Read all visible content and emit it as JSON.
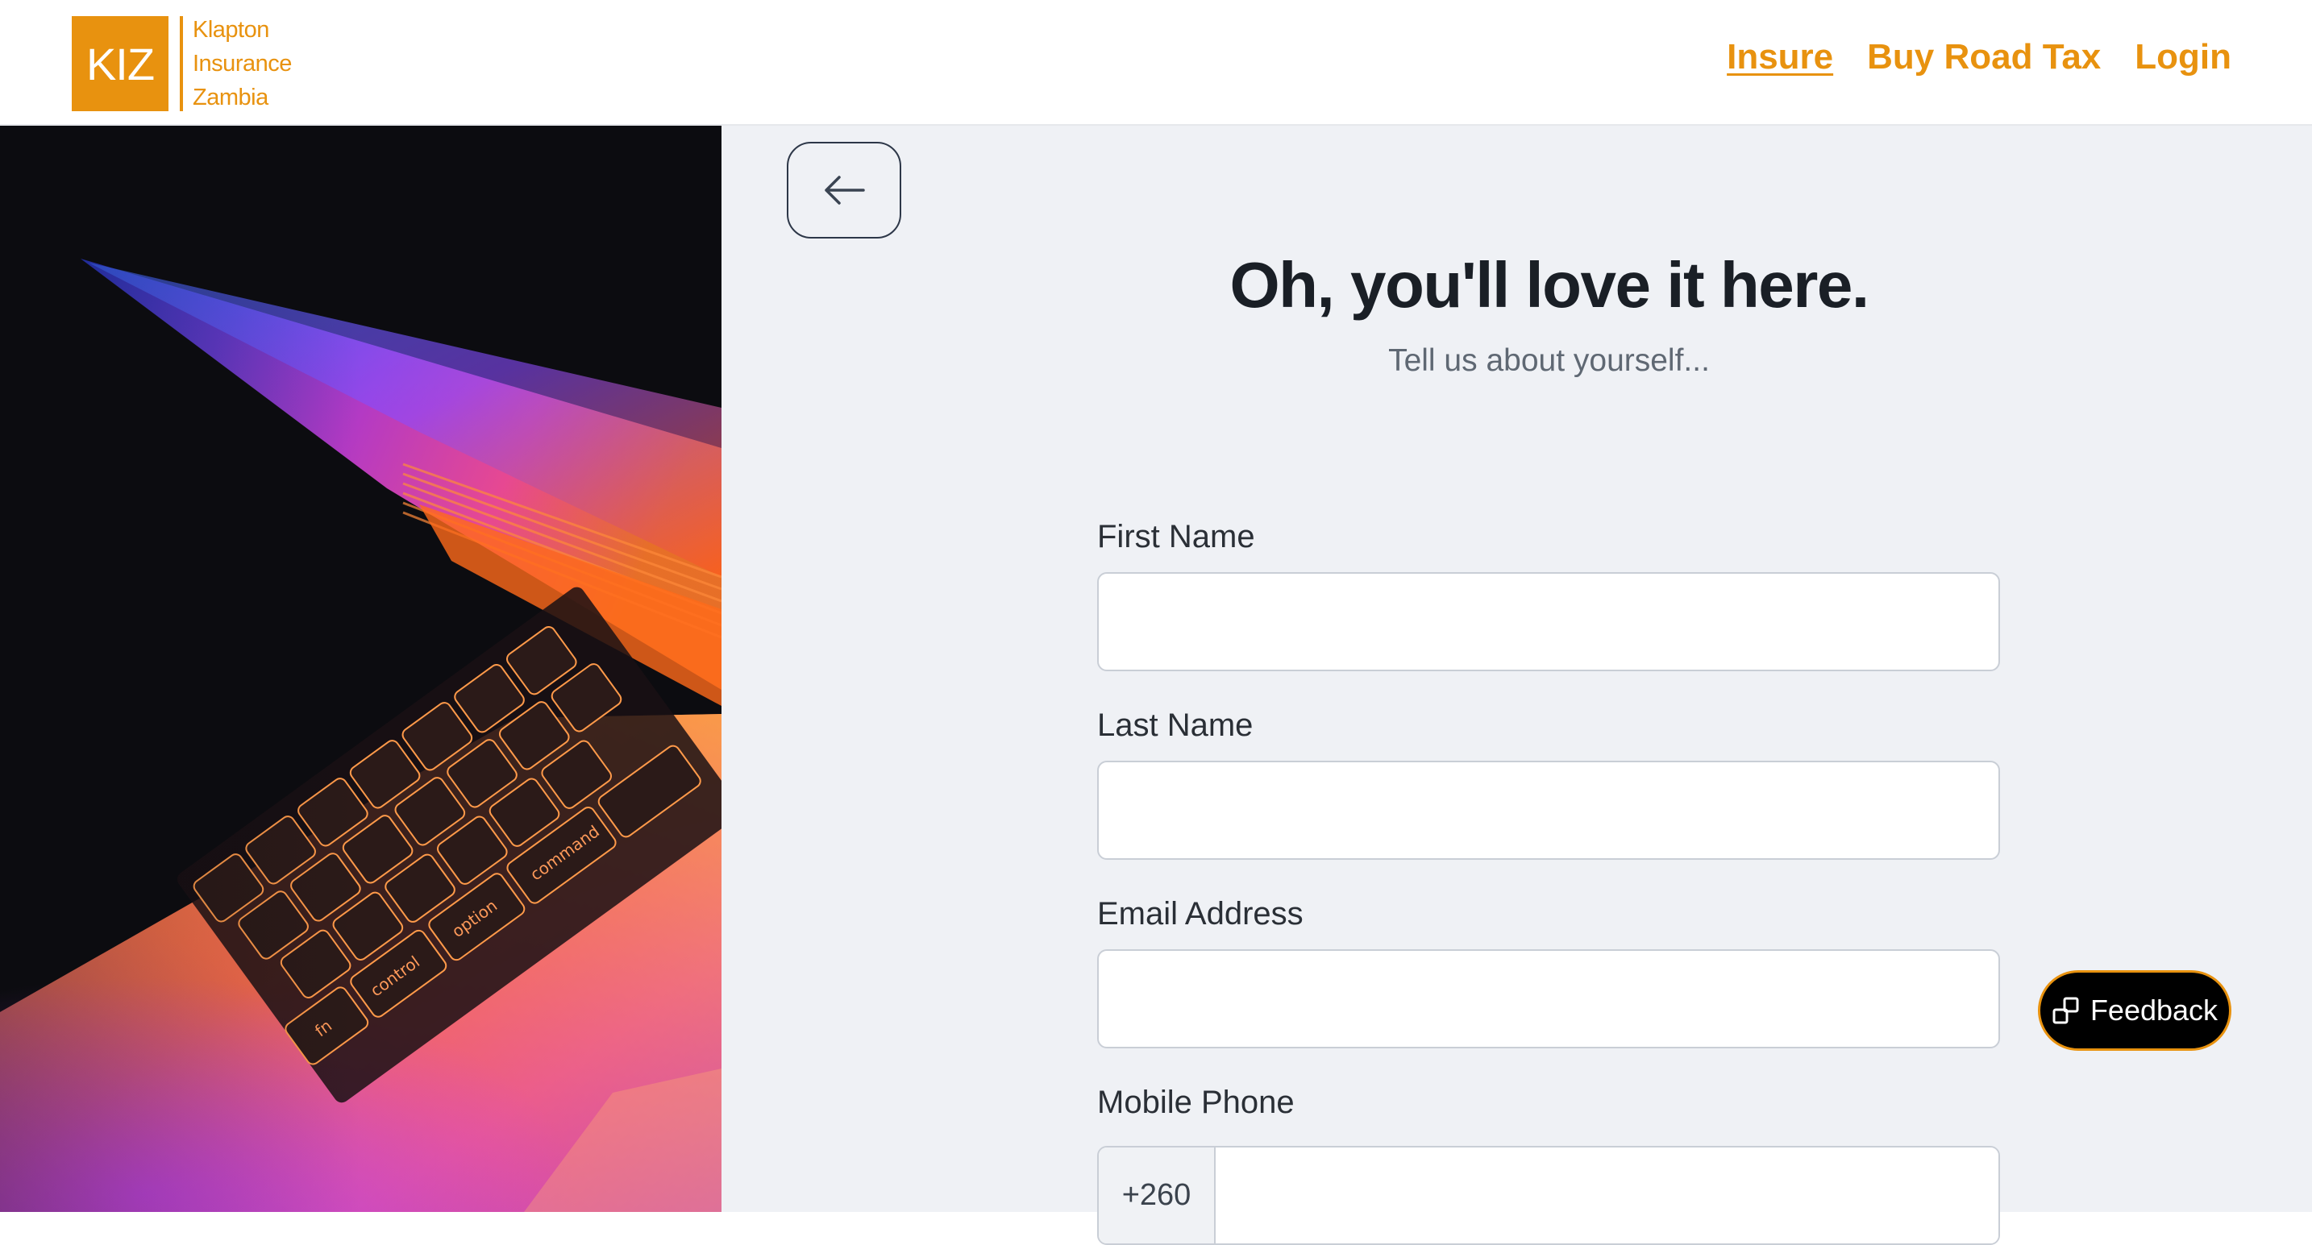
{
  "brand": {
    "logo_mark": "KIZ",
    "name_lines": [
      "Klapton",
      "Insurance",
      "Zambia"
    ],
    "accent_color": "#e8920f"
  },
  "nav": {
    "items": [
      {
        "label": "Insure",
        "active": true
      },
      {
        "label": "Buy Road Tax",
        "active": false
      },
      {
        "label": "Login",
        "active": false
      }
    ]
  },
  "hero": {
    "image_subject": "laptop-keyboard-photo",
    "key_labels": [
      "fn",
      "control",
      "option",
      "command"
    ]
  },
  "form": {
    "back_icon": "arrow-left-icon",
    "title": "Oh, you'll love it here.",
    "subtitle": "Tell us about yourself...",
    "fields": {
      "first_name": {
        "label": "First Name",
        "value": ""
      },
      "last_name": {
        "label": "Last Name",
        "value": ""
      },
      "email": {
        "label": "Email Address",
        "value": ""
      },
      "mobile": {
        "label": "Mobile Phone",
        "prefix": "+260",
        "value": ""
      }
    }
  },
  "feedback": {
    "label": "Feedback",
    "icon": "feedback-icon"
  }
}
